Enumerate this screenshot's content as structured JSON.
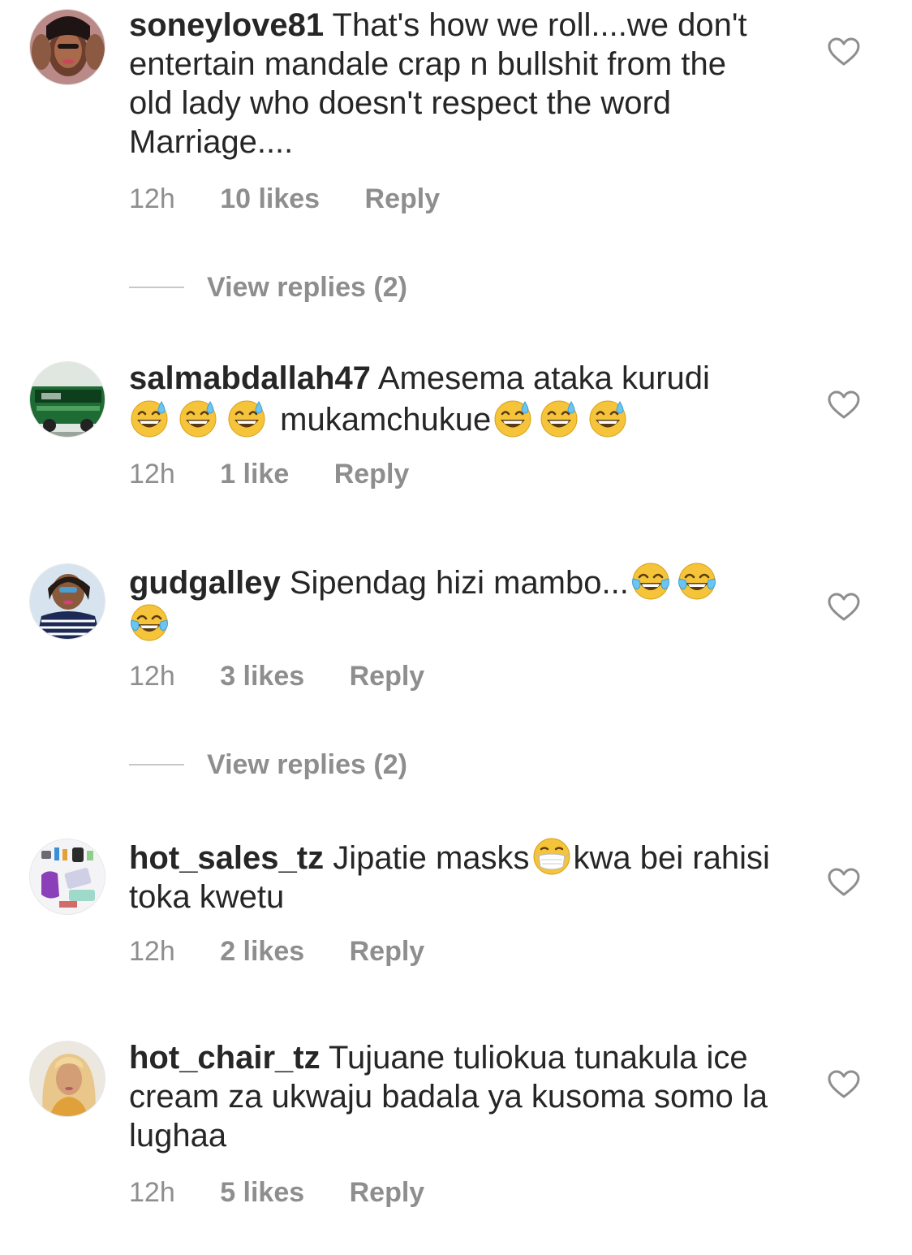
{
  "heart_icon": "heart-outline-icon",
  "colors": {
    "text": "#262626",
    "secondary": "#8e8e8e",
    "divider": "#c7c7c7"
  },
  "comments": [
    {
      "username": "soneylove81",
      "text": "That's how we roll....we don't entertain mandale crap n bullshit from the old lady who doesn't respect the word Marriage....",
      "time": "12h",
      "likes": "10 likes",
      "reply": "Reply"
    },
    {
      "username": "salmabdallah47",
      "text_a": "Amesema ataka kurudi",
      "text_b": "mukamchukue",
      "emoji": "grinning-sweat-emoji",
      "time": "12h",
      "likes": "1 like",
      "reply": "Reply"
    },
    {
      "username": "gudgalley",
      "text": "Sipendag hizi mambo...",
      "emoji": "tears-of-joy-emoji",
      "time": "12h",
      "likes": "3 likes",
      "reply": "Reply"
    },
    {
      "username": "hot_sales_tz",
      "text_a": "Jipatie masks",
      "text_b": "kwa bei rahisi toka kwetu",
      "emoji": "medical-mask-emoji",
      "time": "12h",
      "likes": "2 likes",
      "reply": "Reply"
    },
    {
      "username": "hot_chair_tz",
      "text": "Tujuane tuliokua tunakula ice cream za ukwaju badala ya kusoma somo la lughaa",
      "time": "12h",
      "likes": "5 likes",
      "reply": "Reply"
    }
  ],
  "view_replies": [
    {
      "label": "View replies (2)"
    },
    {
      "label": "View replies (2)"
    }
  ]
}
